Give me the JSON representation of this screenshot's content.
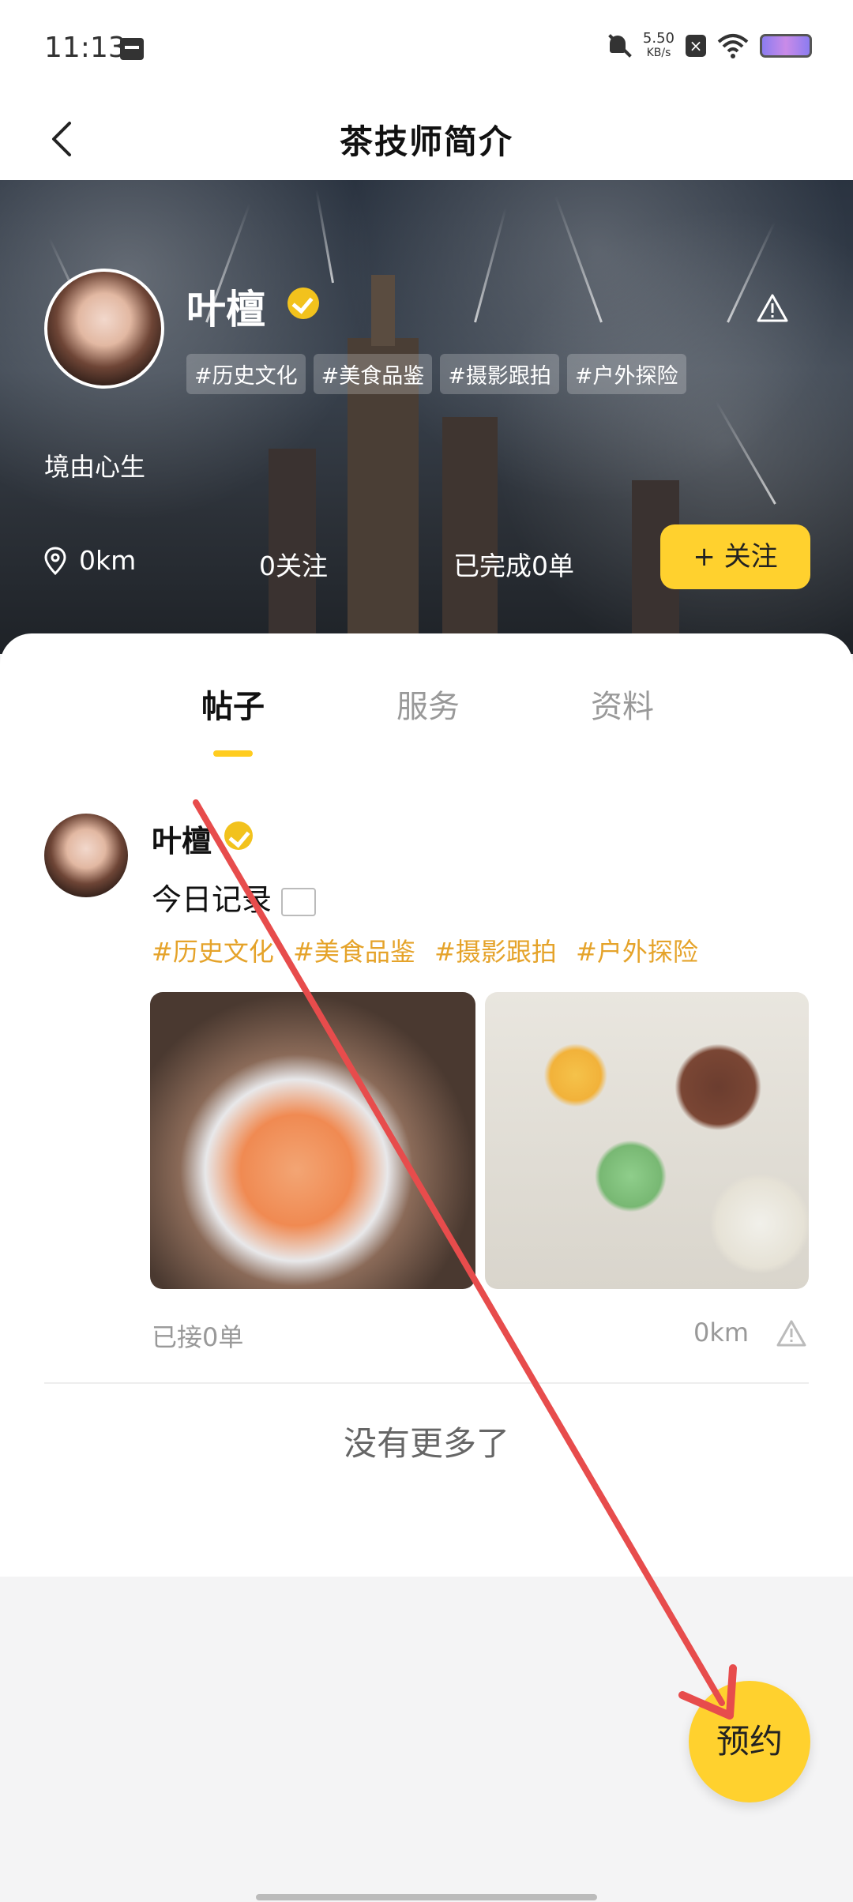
{
  "status": {
    "time": "11:13",
    "net_speed_value": "5.50",
    "net_speed_unit": "KB/s"
  },
  "nav": {
    "title": "茶技师简介"
  },
  "profile": {
    "name": "叶檀",
    "tags": [
      "#历史文化",
      "#美食品鉴",
      "#摄影跟拍",
      "#户外探险"
    ],
    "motto": "境由心生",
    "distance": "0km",
    "followers": "0关注",
    "completed": "已完成0单",
    "follow_label": "+ 关注"
  },
  "tabs": [
    {
      "label": "帖子",
      "active": true
    },
    {
      "label": "服务",
      "active": false
    },
    {
      "label": "资料",
      "active": false
    }
  ],
  "post": {
    "author": "叶檀",
    "text": "今日记录",
    "tags": [
      "#历史文化",
      "#美食品鉴",
      "#摄影跟拍",
      "#户外探险"
    ],
    "received": "已接0单",
    "distance": "0km"
  },
  "footer": {
    "no_more": "没有更多了"
  },
  "book_label": "预约",
  "colors": {
    "accent": "#ffd12e",
    "tag_text": "#e5a32a",
    "verified": "#f2c21d",
    "annotation_arrow": "#e74c4c"
  }
}
